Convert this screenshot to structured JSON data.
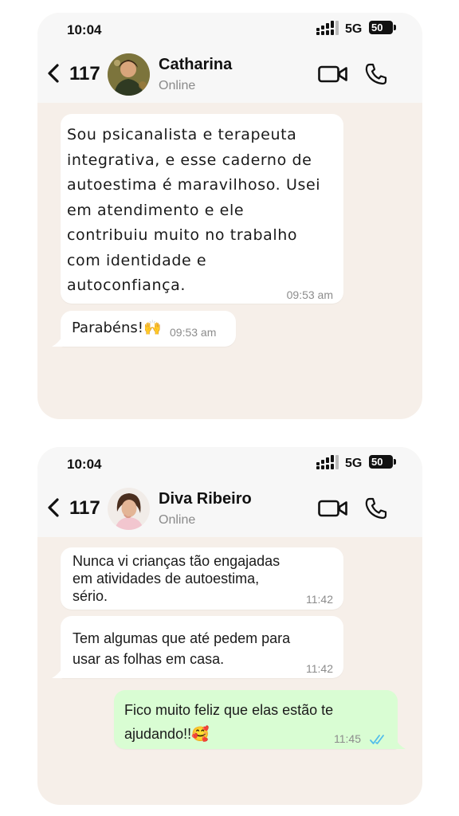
{
  "chats": [
    {
      "status_bar": {
        "time": "10:04",
        "network": "5G",
        "battery": "50"
      },
      "header": {
        "back_count": "117",
        "contact_name": "Catharina",
        "contact_status": "Online",
        "icons": [
          "back-arrow-icon",
          "video-call-icon",
          "phone-call-icon"
        ]
      },
      "messages": [
        {
          "direction": "in",
          "text": "Sou psicanalista e terapeuta\nintegrativa, e esse caderno de\nautoestima é maravilhoso. Usei\nem atendimento e ele\ncontribuiu muito no trabalho\ncom identidade e\nautoconfiança.",
          "time": "09:53 am"
        },
        {
          "direction": "in",
          "text": "Parabéns!🙌",
          "time": "09:53 am"
        }
      ]
    },
    {
      "status_bar": {
        "time": "10:04",
        "network": "5G",
        "battery": "50"
      },
      "header": {
        "back_count": "117",
        "contact_name": "Diva Ribeiro",
        "contact_status": "Online",
        "icons": [
          "back-arrow-icon",
          "video-call-icon",
          "phone-call-icon"
        ]
      },
      "messages": [
        {
          "direction": "in",
          "text": "Nunca vi crianças tão engajadas\nem atividades de autoestima,\nsério.",
          "time": "11:42"
        },
        {
          "direction": "in",
          "text": "Tem algumas que até pedem para\nusar as folhas em casa.",
          "time": "11:42"
        },
        {
          "direction": "out",
          "text": "Fico muito feliz que elas estão te\najudando!!🥰",
          "time": "11:45",
          "read": true
        }
      ]
    }
  ],
  "colors": {
    "incoming_bubble": "#ffffff",
    "outgoing_bubble": "#d9fdd3",
    "chat_background": "#f6efe9",
    "read_ticks": "#53bdeb"
  }
}
